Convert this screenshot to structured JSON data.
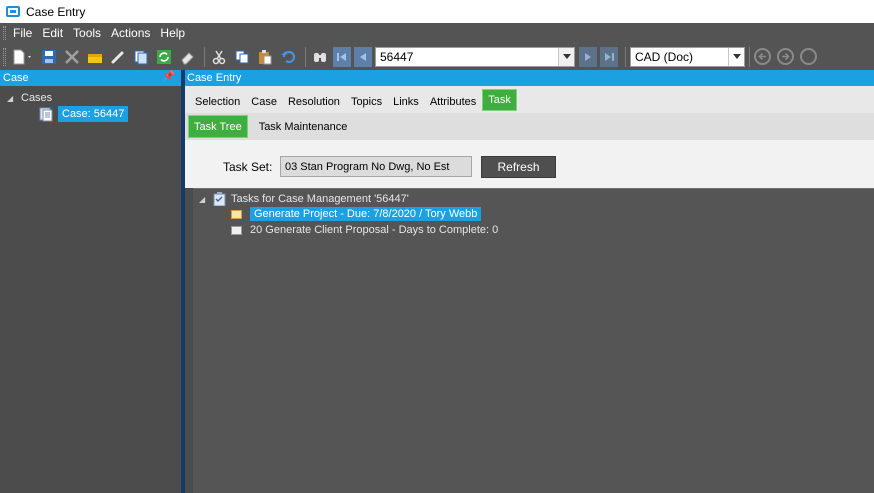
{
  "window": {
    "title": "Case Entry"
  },
  "menu": [
    "File",
    "Edit",
    "Tools",
    "Actions",
    "Help"
  ],
  "toolbar": {
    "record_value": "56447",
    "view_value": "CAD (Doc)"
  },
  "left_panel": {
    "header": "Case",
    "tree": {
      "root_label": "Cases",
      "child_label": "Case: 56447"
    }
  },
  "right_panel": {
    "header": "Case Entry",
    "tabs": [
      "Selection",
      "Case",
      "Resolution",
      "Topics",
      "Links",
      "Attributes",
      "Task"
    ],
    "active_tab": "Task",
    "sub_tabs": [
      "Task Tree",
      "Task Maintenance"
    ],
    "active_sub_tab": "Task Tree",
    "task_set": {
      "label": "Task Set:",
      "value": "03 Stan Program No Dwg, No Est",
      "refresh_label": "Refresh"
    },
    "task_tree": {
      "root_label": "Tasks for Case Management '56447'",
      "items": [
        {
          "label": "Generate Project - Due: 7/8/2020 / Tory Webb",
          "selected": true
        },
        {
          "label": "20 Generate Client Proposal - Days to Complete: 0",
          "selected": false
        }
      ]
    }
  },
  "colors": {
    "accent": "#1ba1e2",
    "active_tab": "#3fae3f",
    "background": "#4c4c4c"
  }
}
